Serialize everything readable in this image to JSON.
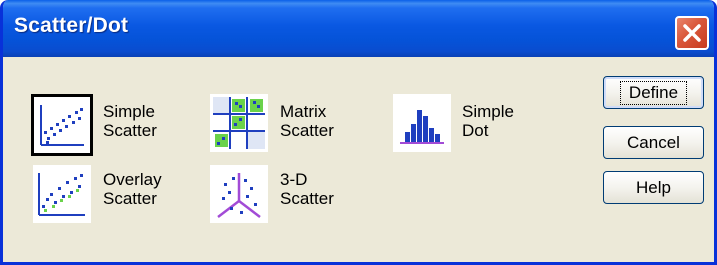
{
  "window": {
    "title": "Scatter/Dot"
  },
  "icons": {
    "close": "close-icon"
  },
  "options": {
    "simple_scatter": {
      "line1": "Simple",
      "line2": "Scatter"
    },
    "matrix_scatter": {
      "line1": "Matrix",
      "line2": "Scatter"
    },
    "simple_dot": {
      "line1": "Simple",
      "line2": "Dot"
    },
    "overlay_scatter": {
      "line1": "Overlay",
      "line2": "Scatter"
    },
    "scatter_3d": {
      "line1": "3-D",
      "line2": "Scatter"
    }
  },
  "buttons": {
    "define": "Define",
    "cancel": "Cancel",
    "help": "Help"
  },
  "colors": {
    "title_bar": "#0a58e2",
    "dialog_bg": "#ece9d8",
    "close_btn": "#d9573a",
    "thumb_accent": "#1f3fbf"
  }
}
